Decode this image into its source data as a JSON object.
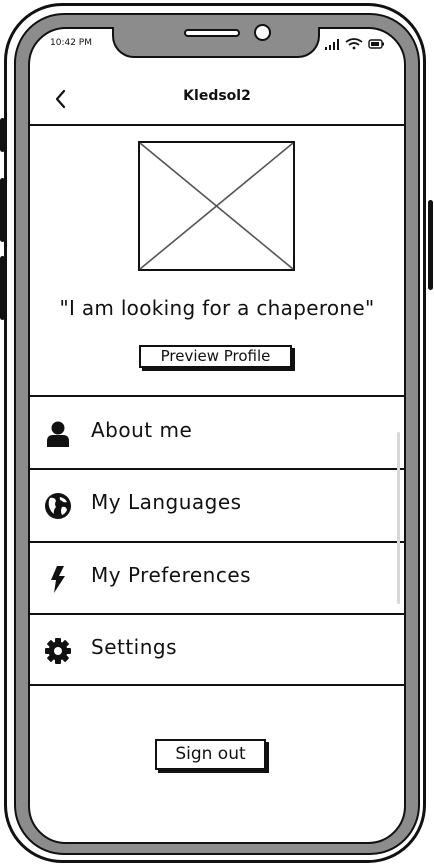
{
  "status_bar": {
    "time": "10:42 PM"
  },
  "header": {
    "title": "Kledsol2"
  },
  "profile": {
    "status_text": "\"I am looking for a chaperone\"",
    "preview_button_label": "Preview Profile"
  },
  "menu": {
    "items": [
      {
        "label": "About me",
        "icon": "person-icon"
      },
      {
        "label": "My Languages",
        "icon": "globe-icon"
      },
      {
        "label": "My Preferences",
        "icon": "lightning-bolt-icon"
      },
      {
        "label": "Settings",
        "icon": "gear-icon"
      }
    ]
  },
  "footer": {
    "sign_out_label": "Sign out"
  }
}
